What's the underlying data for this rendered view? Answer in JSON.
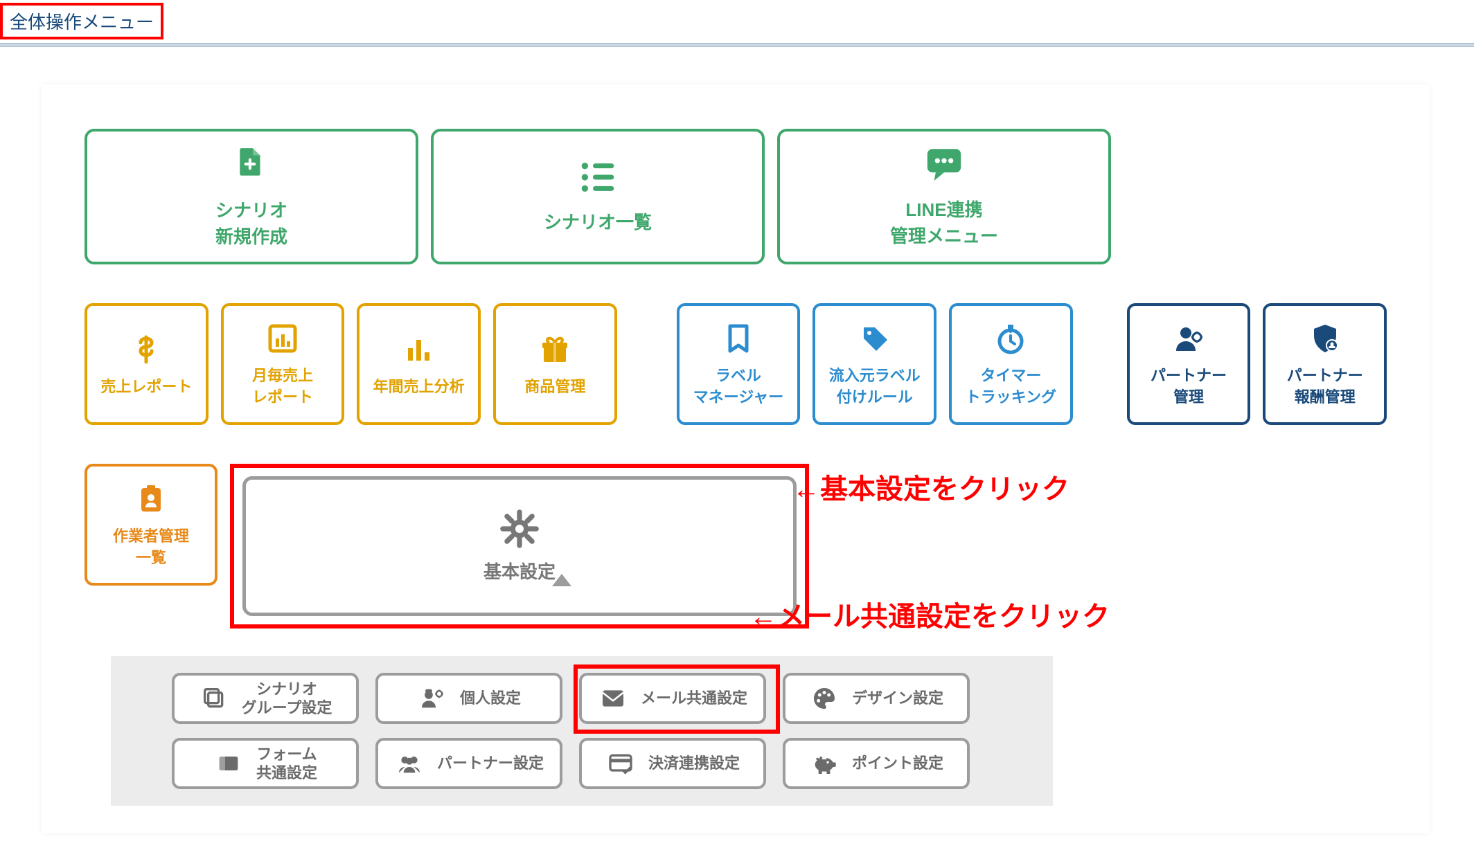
{
  "header": {
    "title": "全体操作メニュー"
  },
  "green_buttons": [
    {
      "id": "scenario-new",
      "label": "シナリオ\n新規作成",
      "icon": "file-plus"
    },
    {
      "id": "scenario-list",
      "label": "シナリオ一覧",
      "icon": "list"
    },
    {
      "id": "line-link",
      "label": "LINE連携\n管理メニュー",
      "icon": "chat"
    }
  ],
  "row2": [
    {
      "id": "sales-report",
      "label": "売上レポート",
      "icon": "dollar",
      "color": "yellow"
    },
    {
      "id": "monthly-sales",
      "label": "月毎売上\nレポート",
      "icon": "bar-chart-box",
      "color": "yellow"
    },
    {
      "id": "annual-sales",
      "label": "年間売上分析",
      "icon": "bar-chart",
      "color": "yellow"
    },
    {
      "id": "product-mgmt",
      "label": "商品管理",
      "icon": "gift",
      "color": "yellow"
    },
    {
      "id": "label-manager",
      "label": "ラベル\nマネージャー",
      "icon": "bookmark",
      "color": "blue"
    },
    {
      "id": "inflow-label-rule",
      "label": "流入元ラベル\n付けルール",
      "icon": "tag",
      "color": "blue"
    },
    {
      "id": "timer-tracking",
      "label": "タイマー\nトラッキング",
      "icon": "stopwatch",
      "color": "blue"
    },
    {
      "id": "partner-mgmt",
      "label": "パートナー\n管理",
      "icon": "user-gear",
      "color": "darkblue"
    },
    {
      "id": "partner-reward",
      "label": "パートナー\n報酬管理",
      "icon": "shield-user",
      "color": "darkblue"
    }
  ],
  "row3": {
    "worker_list": {
      "label": "作業者管理\n一覧",
      "icon": "id-badge"
    },
    "basic_settings": {
      "label": "基本設定",
      "icon": "gear"
    }
  },
  "annotations": {
    "basic_settings_click": "←基本設定をクリック",
    "mail_settings_click": "←メール共通設定をクリック"
  },
  "sub_buttons_row1": [
    {
      "id": "scenario-group-settings",
      "label": "シナリオ\nグループ設定",
      "icon": "copies"
    },
    {
      "id": "personal-settings",
      "label": "個人設定",
      "icon": "worker-gear"
    },
    {
      "id": "mail-common-settings",
      "label": "メール共通設定",
      "icon": "mail"
    },
    {
      "id": "design-settings",
      "label": "デザイン設定",
      "icon": "palette"
    }
  ],
  "sub_buttons_row2": [
    {
      "id": "form-common-settings",
      "label": "フォーム\n共通設定",
      "icon": "form"
    },
    {
      "id": "partner-settings",
      "label": "パートナー設定",
      "icon": "people"
    },
    {
      "id": "payment-link-settings",
      "label": "決済連携設定",
      "icon": "card-check"
    },
    {
      "id": "point-settings",
      "label": "ポイント設定",
      "icon": "piggy"
    }
  ],
  "colors": {
    "green": "#3fa76b",
    "yellow": "#e2a300",
    "blue": "#2b8ccf",
    "darkblue": "#1a4a7a",
    "orange": "#e78a1a",
    "gray": "#9c9c9c",
    "red": "#ff0000"
  }
}
